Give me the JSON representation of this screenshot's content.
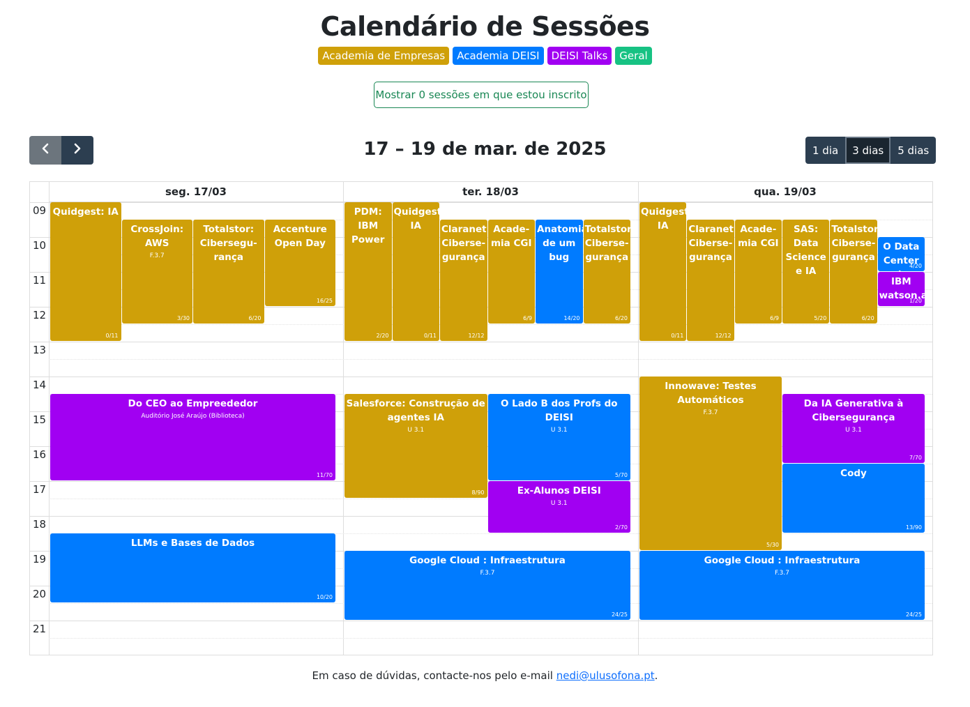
{
  "title": "Calendário de Sessões",
  "legend": [
    {
      "label": "Academia de Empresas",
      "color": "#cfa009"
    },
    {
      "label": "Academia DEISI",
      "color": "#007bff"
    },
    {
      "label": "DEISI Talks",
      "color": "#a100f2"
    },
    {
      "label": "Geral",
      "color": "#17c283"
    }
  ],
  "enrolled_button": "Mostrar 0 sessões em que estou inscrito",
  "nav": {
    "prev_icon": "chevron-left-icon",
    "next_icon": "chevron-right-icon"
  },
  "range_title": "17 – 19 de mar. de 2025",
  "views": [
    {
      "label": "1 dia",
      "active": false
    },
    {
      "label": "3 dias",
      "active": true
    },
    {
      "label": "5 dias",
      "active": false
    }
  ],
  "days": [
    "seg. 17/03",
    "ter. 18/03",
    "qua. 19/03"
  ],
  "hours": [
    "09",
    "10",
    "11",
    "12",
    "13",
    "14",
    "15",
    "16",
    "17",
    "18",
    "19",
    "20",
    "21"
  ],
  "colors": {
    "empresas": "#cfa009",
    "deisi": "#007bff",
    "talks": "#a100f2",
    "geral": "#17c283"
  },
  "events": [
    {
      "day": 0,
      "title": "Quidgest: IA",
      "start": 9.0,
      "end": 13.0,
      "col": 0,
      "cols": 4,
      "type": "empresas",
      "room": "",
      "count": "0/11"
    },
    {
      "day": 0,
      "title": "CrossJoin: AWS",
      "start": 9.5,
      "end": 12.5,
      "col": 1,
      "cols": 4,
      "type": "empresas",
      "room": "F.3.7",
      "count": "3/30"
    },
    {
      "day": 0,
      "title": "Totalstor: Cibersegu-rança",
      "start": 9.5,
      "end": 12.5,
      "col": 2,
      "cols": 4,
      "type": "empresas",
      "room": "",
      "count": "6/20"
    },
    {
      "day": 0,
      "title": "Accenture Open Day",
      "start": 9.5,
      "end": 12.0,
      "col": 3,
      "cols": 4,
      "type": "empresas",
      "room": "",
      "count": "16/25"
    },
    {
      "day": 0,
      "title": "Do CEO ao Empreededor",
      "start": 14.5,
      "end": 17.0,
      "col": 0,
      "cols": 1,
      "type": "talks",
      "room": "Auditório José Araújo (Biblioteca)",
      "count": "11/70"
    },
    {
      "day": 0,
      "title": "LLMs e Bases de Dados",
      "start": 18.5,
      "end": 20.5,
      "col": 0,
      "cols": 1,
      "type": "deisi",
      "room": "",
      "count": "10/20"
    },
    {
      "day": 1,
      "title": "PDM: IBM Power",
      "start": 9.0,
      "end": 13.0,
      "col": 0,
      "cols": 6,
      "type": "empresas",
      "room": "",
      "count": "2/20"
    },
    {
      "day": 1,
      "title": "Quidgest: IA",
      "start": 9.0,
      "end": 13.0,
      "col": 1,
      "cols": 6,
      "type": "empresas",
      "room": "",
      "count": "0/11"
    },
    {
      "day": 1,
      "title": "Claranet: Ciberse-gurança",
      "start": 9.5,
      "end": 13.0,
      "col": 2,
      "cols": 6,
      "type": "empresas",
      "room": "",
      "count": "12/12"
    },
    {
      "day": 1,
      "title": "Acade-mia CGI",
      "start": 9.5,
      "end": 12.5,
      "col": 3,
      "cols": 6,
      "type": "empresas",
      "room": "",
      "count": "6/9"
    },
    {
      "day": 1,
      "title": "Anatomia de um bug",
      "start": 9.5,
      "end": 12.5,
      "col": 4,
      "cols": 6,
      "type": "deisi",
      "room": "",
      "count": "14/20"
    },
    {
      "day": 1,
      "title": "Totalstor: Ciberse-gurança",
      "start": 9.5,
      "end": 12.5,
      "col": 5,
      "cols": 6,
      "type": "empresas",
      "room": "",
      "count": "6/20"
    },
    {
      "day": 1,
      "title": "Salesforce: Construção de agentes IA",
      "start": 14.5,
      "end": 17.5,
      "col": 0,
      "cols": 2,
      "type": "empresas",
      "room": "U 3.1",
      "count": "8/90"
    },
    {
      "day": 1,
      "title": "O Lado B dos Profs do DEISI",
      "start": 14.5,
      "end": 17.0,
      "col": 1,
      "cols": 2,
      "type": "deisi",
      "room": "U 3.1",
      "count": "5/70"
    },
    {
      "day": 1,
      "title": "Ex-Alunos DEISI",
      "start": 17.0,
      "end": 18.5,
      "col": 1,
      "cols": 2,
      "type": "talks",
      "room": "U 3.1",
      "count": "2/70"
    },
    {
      "day": 1,
      "title": "Google Cloud : Infraestrutura",
      "start": 19.0,
      "end": 21.0,
      "col": 0,
      "cols": 1,
      "type": "deisi",
      "room": "F.3.7",
      "count": "24/25"
    },
    {
      "day": 2,
      "title": "Quidgest: IA",
      "start": 9.0,
      "end": 13.0,
      "col": 0,
      "cols": 6,
      "type": "empresas",
      "room": "",
      "count": "0/11"
    },
    {
      "day": 2,
      "title": "Claranet: Ciberse-gurança",
      "start": 9.5,
      "end": 13.0,
      "col": 1,
      "cols": 6,
      "type": "empresas",
      "room": "",
      "count": "12/12"
    },
    {
      "day": 2,
      "title": "Acade-mia CGI",
      "start": 9.5,
      "end": 12.5,
      "col": 2,
      "cols": 6,
      "type": "empresas",
      "room": "",
      "count": "6/9"
    },
    {
      "day": 2,
      "title": "SAS: Data Science e IA",
      "start": 9.5,
      "end": 12.5,
      "col": 3,
      "cols": 6,
      "type": "empresas",
      "room": "",
      "count": "5/20"
    },
    {
      "day": 2,
      "title": "Totalstor: Ciberse-gurança",
      "start": 9.5,
      "end": 12.5,
      "col": 4,
      "cols": 6,
      "type": "empresas",
      "room": "",
      "count": "6/20"
    },
    {
      "day": 2,
      "title": "O Data Center da",
      "start": 10.0,
      "end": 11.0,
      "col": 5,
      "cols": 6,
      "type": "deisi",
      "room": "",
      "count": "4/20"
    },
    {
      "day": 2,
      "title": "IBM watson.ai",
      "start": 11.0,
      "end": 12.0,
      "col": 5,
      "cols": 6,
      "type": "talks",
      "room": "",
      "count": "1/20"
    },
    {
      "day": 2,
      "title": "Innowave: Testes Automáticos",
      "start": 14.0,
      "end": 19.0,
      "col": 0,
      "cols": 2,
      "type": "empresas",
      "room": "F.3.7",
      "count": "5/30"
    },
    {
      "day": 2,
      "title": "Da IA Generativa à Cibersegurança",
      "start": 14.5,
      "end": 16.5,
      "col": 1,
      "cols": 2,
      "type": "talks",
      "room": "U 3.1",
      "count": "7/70"
    },
    {
      "day": 2,
      "title": "Cody",
      "start": 16.5,
      "end": 18.5,
      "col": 1,
      "cols": 2,
      "type": "deisi",
      "room": "",
      "count": "13/90"
    },
    {
      "day": 2,
      "title": "Google Cloud : Infraestrutura",
      "start": 19.0,
      "end": 21.0,
      "col": 0,
      "cols": 1,
      "type": "deisi",
      "room": "F.3.7",
      "count": "24/25"
    }
  ],
  "footer": {
    "text": "Em caso de dúvidas, contacte-nos pelo e-mail ",
    "email": "nedi@ulusofona.pt",
    "suffix": "."
  }
}
